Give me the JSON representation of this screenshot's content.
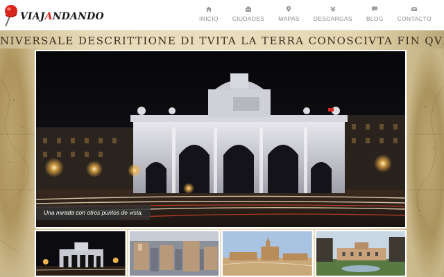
{
  "brand": {
    "name_part1": "VIAJ",
    "name_accent": "A",
    "name_part2": "NDANDO"
  },
  "nav": [
    {
      "label": "INICIO",
      "icon": "home-icon"
    },
    {
      "label": "CIUDADES",
      "icon": "building-icon"
    },
    {
      "label": "MAPAS",
      "icon": "map-marker-icon"
    },
    {
      "label": "DESCARGAS",
      "icon": "download-icon"
    },
    {
      "label": "BLOG",
      "icon": "chat-icon"
    },
    {
      "label": "CONTACTO",
      "icon": "envelope-icon"
    }
  ],
  "map_title": "NIVERSALE DESCRITTIONE DI TVITA LA TERRA CONOSCIVTA FIN QVI",
  "hero": {
    "caption": "Una mirada con otros puntos de vista."
  },
  "colors": {
    "accent": "#d9261c",
    "nav_text": "#8a8a8a"
  }
}
